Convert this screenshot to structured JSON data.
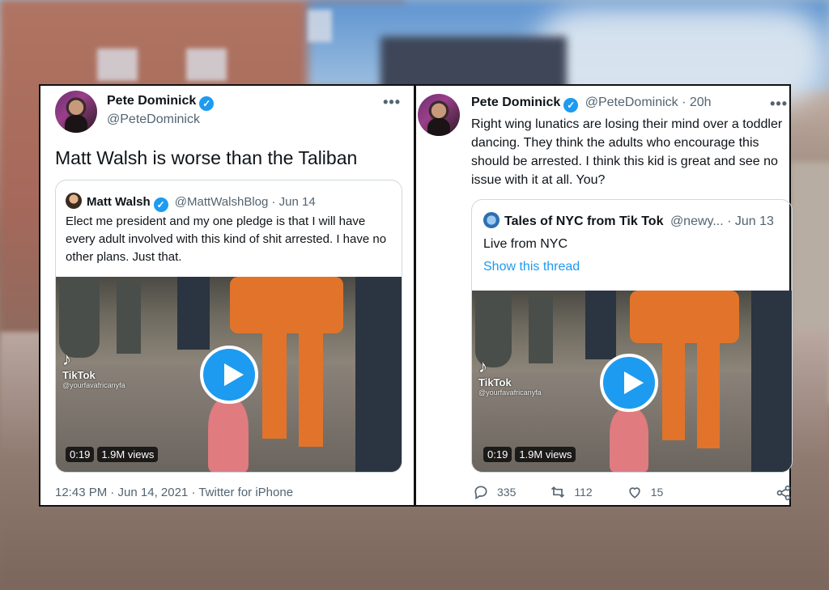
{
  "left_tweet": {
    "author_name": "Pete Dominick",
    "author_handle": "@PeteDominick",
    "more_label": "•••",
    "text": "Matt Walsh is worse than the Taliban",
    "quoted": {
      "author_name": "Matt Walsh",
      "meta": "@MattWalshBlog · Jun 14",
      "text": "Elect me president and my one pledge is that I will have every adult involved with this kind of shit arrested. I have no other plans. Just that.",
      "video": {
        "duration": "0:19",
        "views": "1.9M views",
        "watermark_brand": "TikTok",
        "watermark_user": "@yourfavafricanyfa"
      }
    },
    "timestamp": "12:43 PM · Jun 14, 2021 · Twitter for iPhone"
  },
  "right_tweet": {
    "author_name": "Pete Dominick",
    "author_meta": "@PeteDominick · 20h",
    "more_label": "•••",
    "text": "Right wing lunatics are losing their mind over a toddler dancing. They think the adults who encourage this should be arrested. I think this kid is great and see no issue with it at all. You?",
    "quoted": {
      "author_name": "Tales of NYC from Tik Tok",
      "meta": "@newy... · Jun 13",
      "text": "Live from NYC",
      "show_thread": "Show this thread",
      "video": {
        "duration": "0:19",
        "views": "1.9M views",
        "watermark_brand": "TikTok",
        "watermark_user": "@yourfavafricanyfa"
      }
    },
    "actions": {
      "replies": "335",
      "retweets": "112",
      "likes": "15"
    }
  },
  "colors": {
    "accent": "#1d9bf0",
    "secondary_text": "#536471",
    "primary_text": "#0f1419"
  }
}
